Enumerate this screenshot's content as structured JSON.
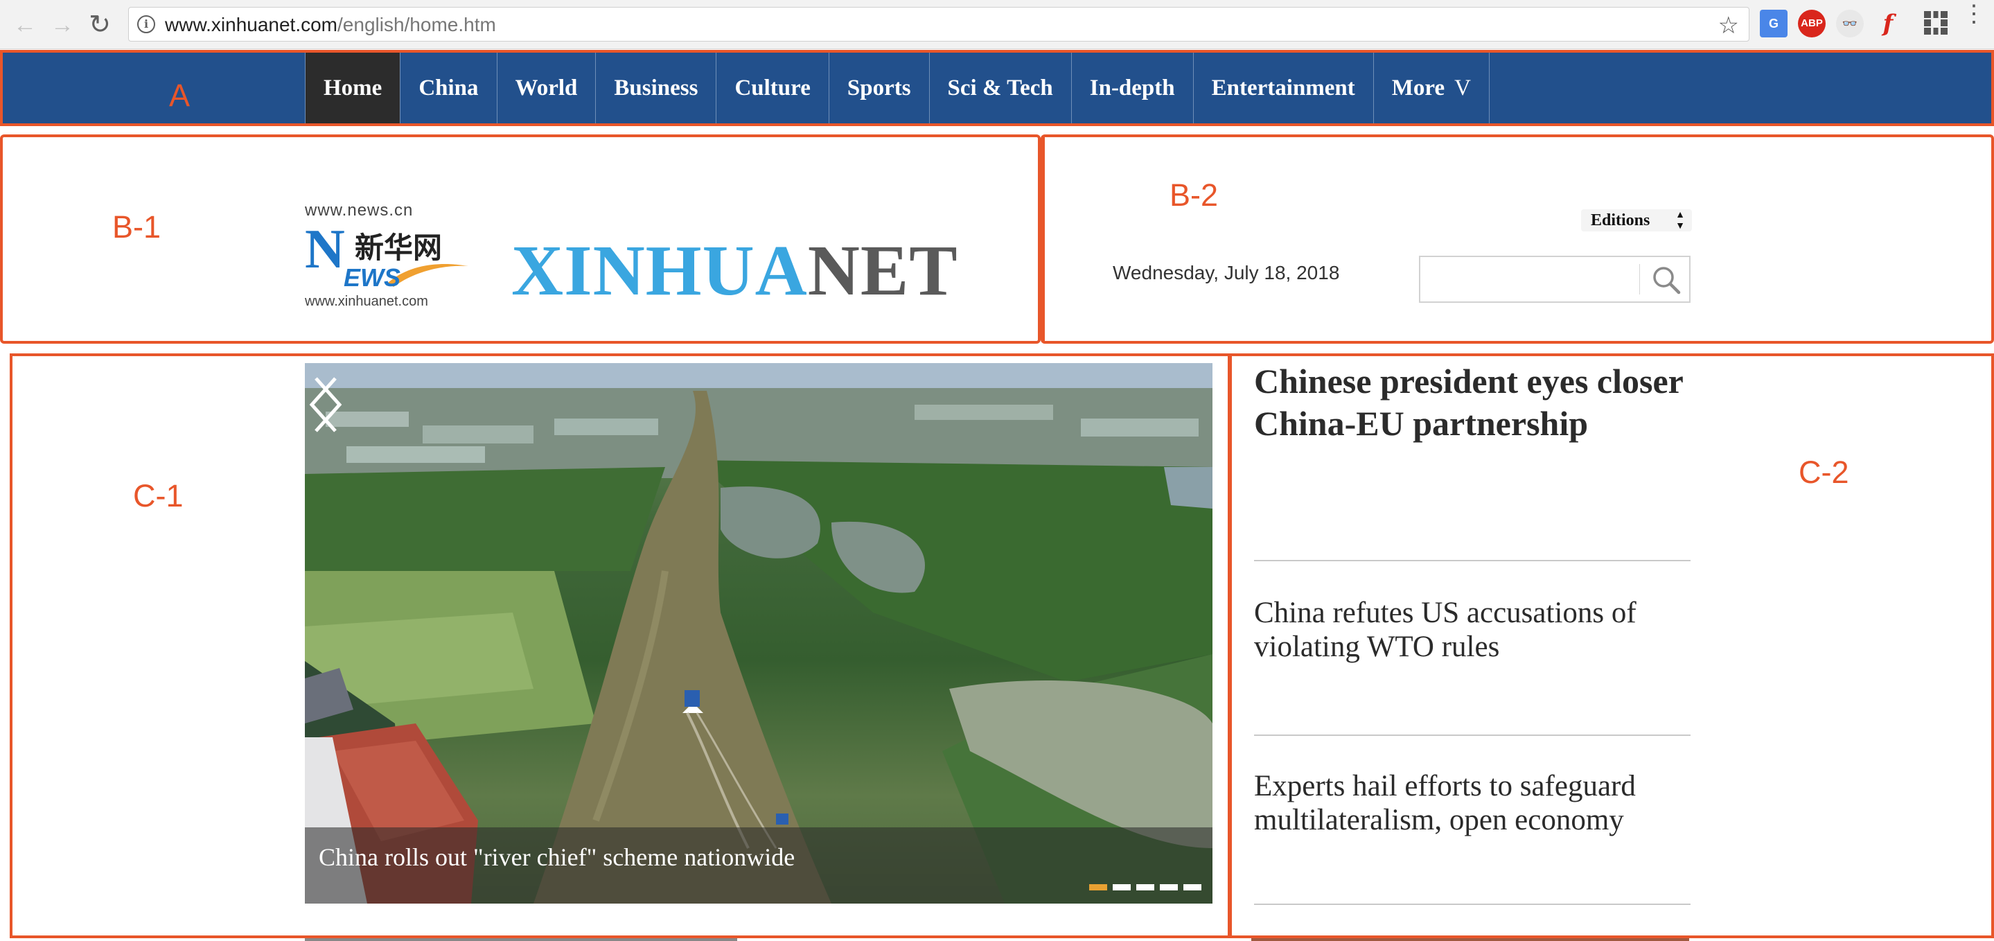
{
  "browser": {
    "url_host": "www.xinhuanet.com",
    "url_path": "/english/home.htm",
    "back_icon": "back-arrow-icon",
    "forward_icon": "forward-arrow-icon",
    "reload_icon": "reload-icon",
    "info_icon_glyph": "i",
    "star_glyph": "☆",
    "extensions": {
      "translate_label": "G",
      "abp_label": "ABP",
      "owl_label": "👓",
      "flash_label": "f"
    },
    "menu_glyph": "⋮"
  },
  "nav": {
    "items": [
      {
        "label": "Home"
      },
      {
        "label": "China"
      },
      {
        "label": "World"
      },
      {
        "label": "Business"
      },
      {
        "label": "Culture"
      },
      {
        "label": "Sports"
      },
      {
        "label": "Sci & Tech"
      },
      {
        "label": "In-depth"
      },
      {
        "label": "Entertainment"
      },
      {
        "label": "More"
      }
    ],
    "active_index": 0,
    "more_chevron": "V",
    "background": "#22508c",
    "active_background": "#2c2c2c"
  },
  "annotations": {
    "a": "A",
    "b1": "B-1",
    "b2": "B-2",
    "c1": "C-1",
    "c2": "C-2",
    "color": "#e8562a"
  },
  "header": {
    "logo_url_top": "www.news.cn",
    "logo_n": "N",
    "logo_cn": "新华网",
    "logo_ews": "EWS",
    "logo_url_bottom": "www.xinhuanet.com",
    "wordmark_part1": "XINHUA",
    "wordmark_part2": "NET",
    "editions_label": "Editions",
    "editions_arrows": "▲▼",
    "date": "Wednesday, July  18, 2018",
    "search_placeholder": "",
    "search_icon": "search-icon"
  },
  "carousel": {
    "caption": "China rolls out \"river chief\" scheme nationwide",
    "slide_count": 5,
    "active_slide": 0,
    "prev_icon": "chevron-left-icon",
    "next_icon": "chevron-right-icon"
  },
  "headlines": {
    "main": "Chinese president eyes closer China-EU partnership",
    "items": [
      "China refutes US accusations of violating WTO rules",
      "Experts hail efforts to safeguard multilateralism, open economy"
    ]
  }
}
